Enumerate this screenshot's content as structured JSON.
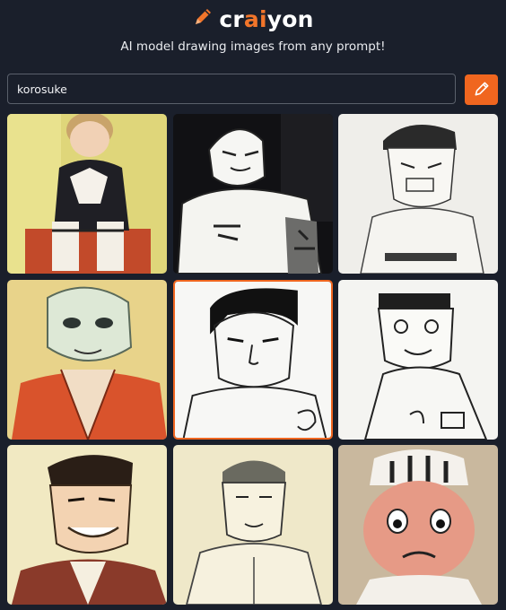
{
  "brand": {
    "prefix": "cr",
    "accent": "ai",
    "suffix": "yon",
    "accent_color": "#f2752a"
  },
  "tagline": "AI model drawing images from any prompt!",
  "search": {
    "value": "korosuke",
    "placeholder": ""
  },
  "draw_button": {
    "icon": "pencil-icon",
    "color": "#f0661f"
  },
  "results": {
    "selected_index": 4,
    "images": [
      {
        "style": "painted yellow background"
      },
      {
        "style": "ink on black"
      },
      {
        "style": "pencil sketch"
      },
      {
        "style": "painted orange robe"
      },
      {
        "style": "ink line art"
      },
      {
        "style": "ink sketch on white"
      },
      {
        "style": "cartoon on cream"
      },
      {
        "style": "sketch on cream"
      },
      {
        "style": "anime painted"
      }
    ]
  }
}
